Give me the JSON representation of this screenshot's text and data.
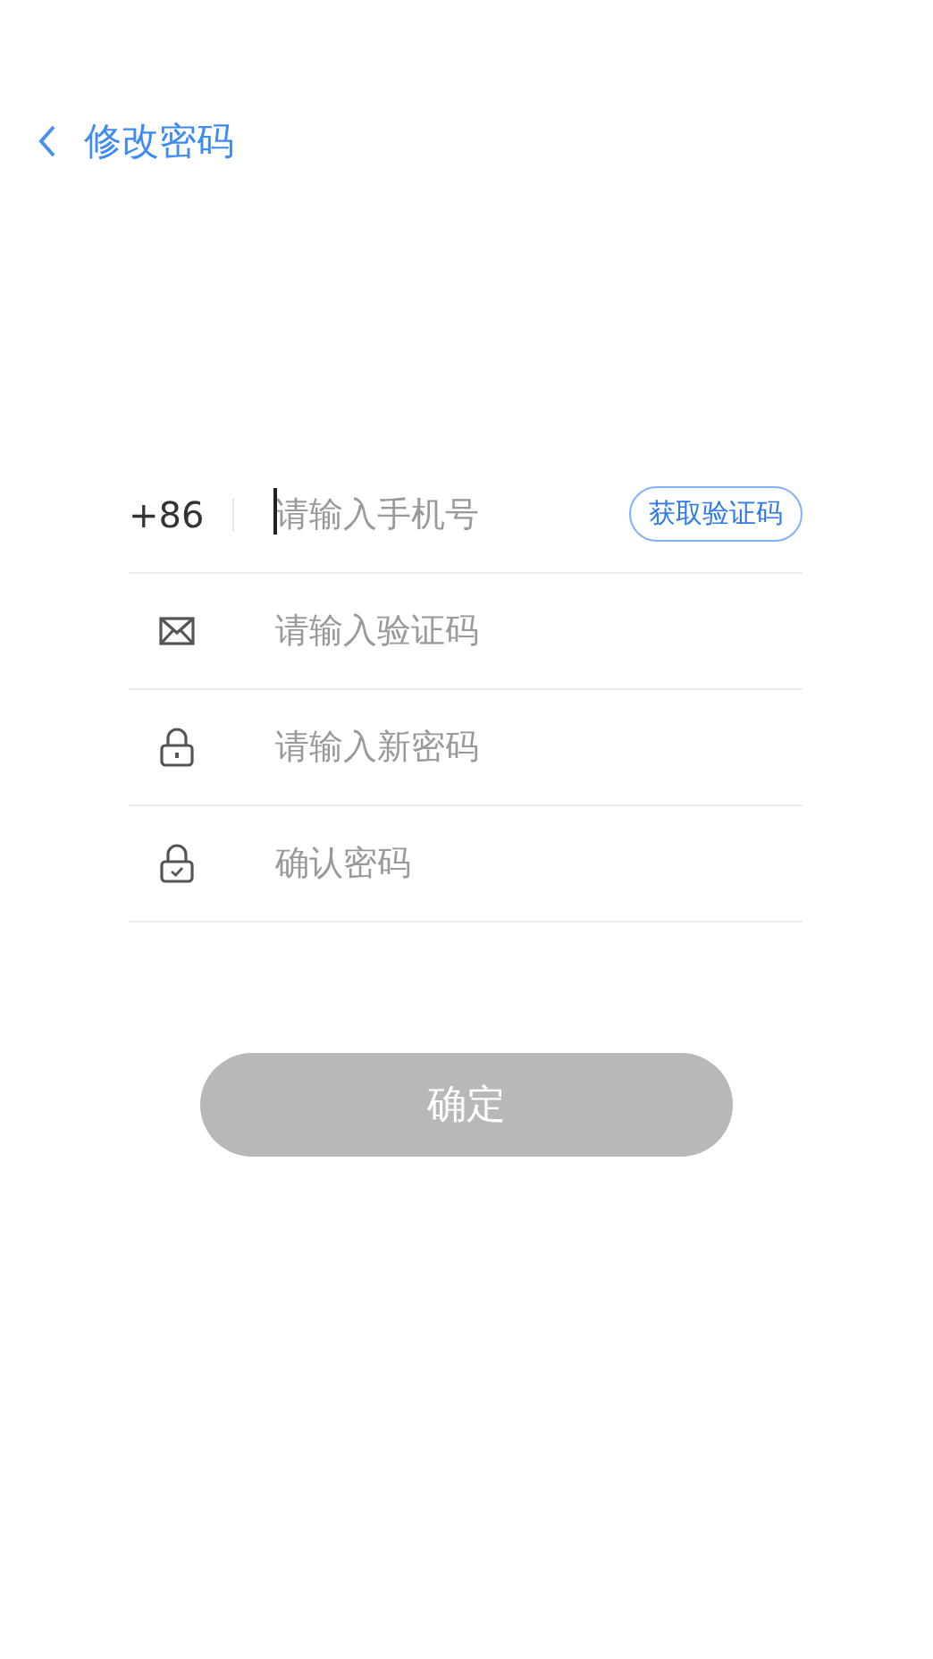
{
  "header": {
    "title": "修改密码"
  },
  "fields": [
    {
      "kind": "phone",
      "prefix": "+86",
      "placeholder": "请输入手机号",
      "focused": true,
      "action": "获取验证码"
    },
    {
      "kind": "code",
      "placeholder": "请输入验证码",
      "focused": false
    },
    {
      "kind": "password",
      "placeholder": "请输入新密码",
      "focused": false
    },
    {
      "kind": "confirm",
      "placeholder": "确认密码",
      "focused": false
    }
  ],
  "submit": {
    "label": "确定",
    "disabled": true
  }
}
